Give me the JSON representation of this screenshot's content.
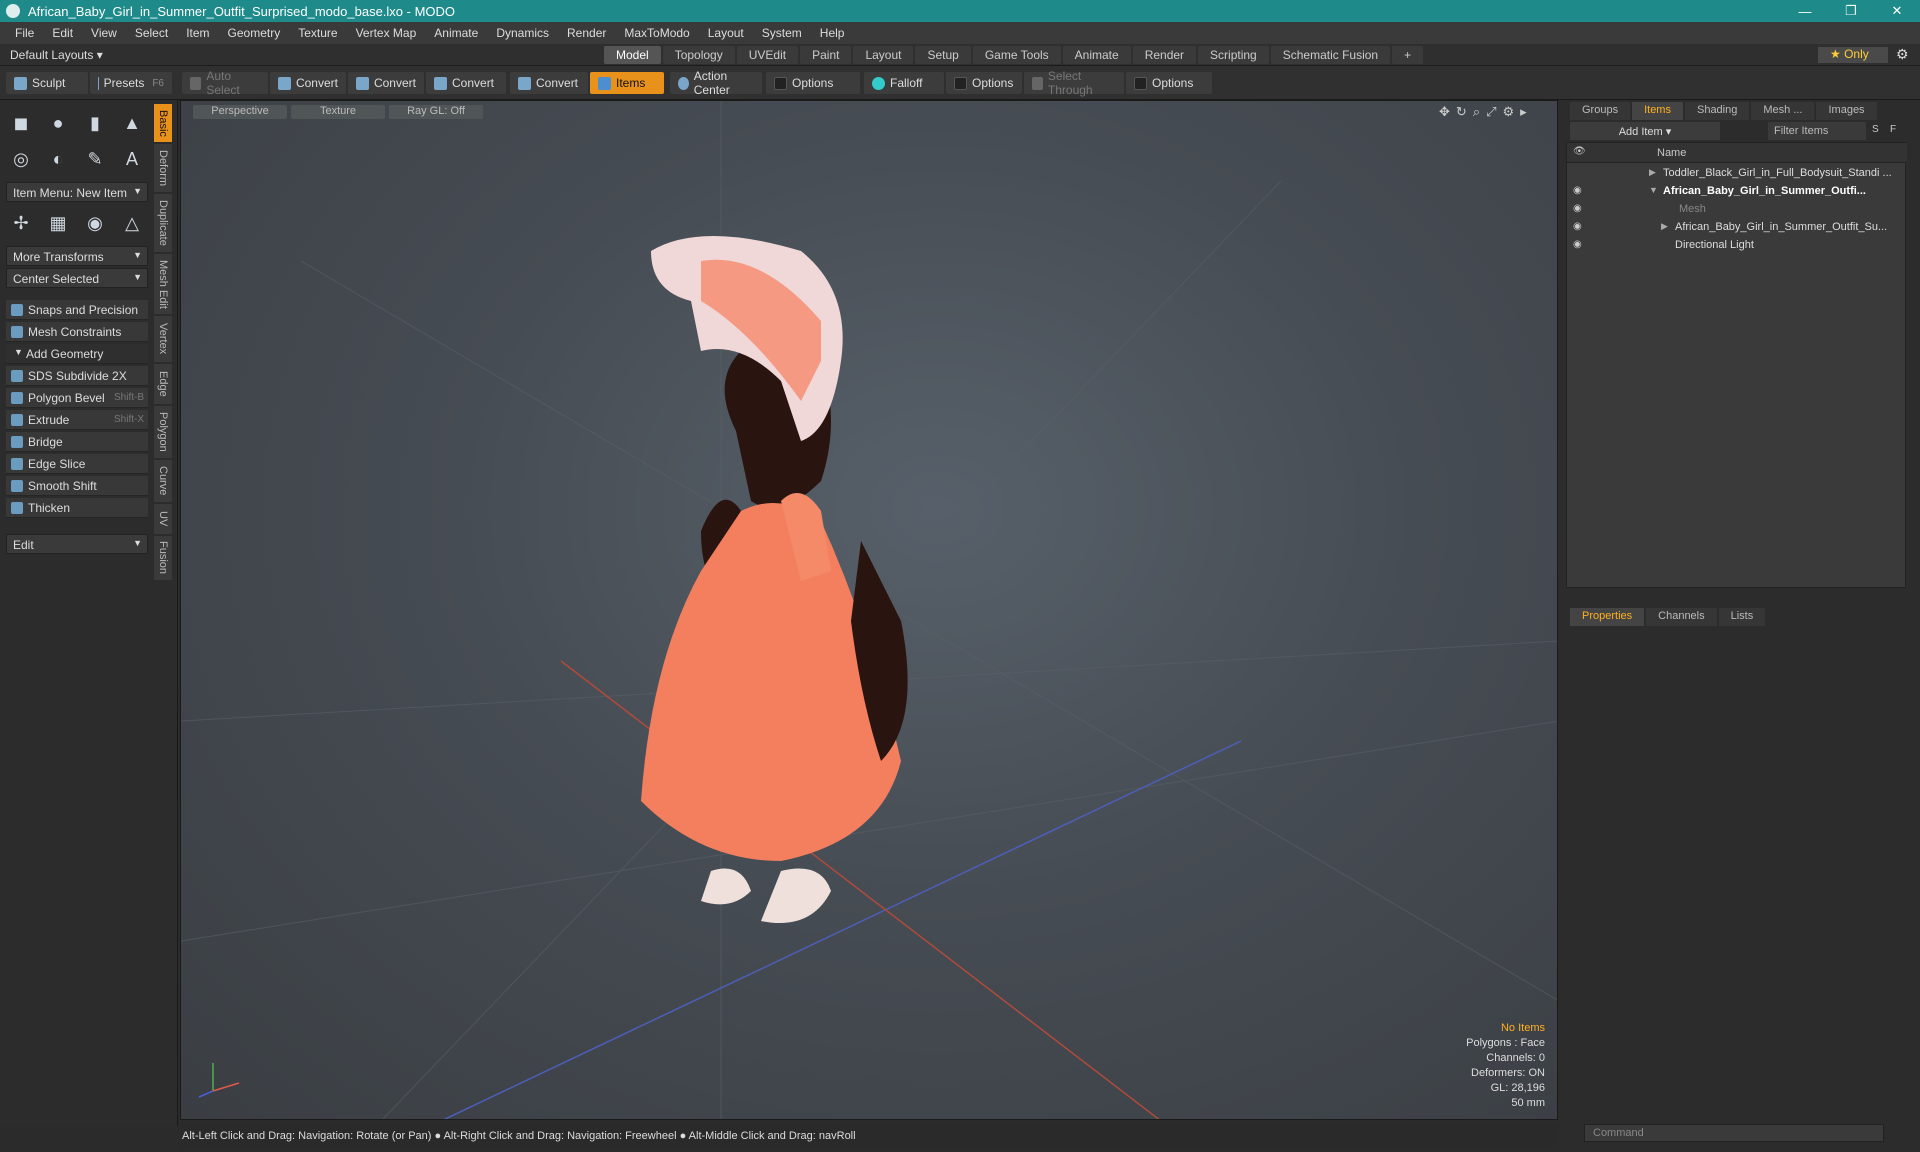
{
  "window": {
    "title": "African_Baby_Girl_in_Summer_Outfit_Surprised_modo_base.lxo - MODO",
    "minimize": "—",
    "restore": "❐",
    "close": "✕"
  },
  "menu": [
    "File",
    "Edit",
    "View",
    "Select",
    "Item",
    "Geometry",
    "Texture",
    "Vertex Map",
    "Animate",
    "Dynamics",
    "Render",
    "MaxToModo",
    "Layout",
    "System",
    "Help"
  ],
  "layoutbar": {
    "default_layouts": "Default Layouts ▾",
    "tabs": [
      "Model",
      "Topology",
      "UVEdit",
      "Paint",
      "Layout",
      "Setup",
      "Game Tools",
      "Animate",
      "Render",
      "Scripting",
      "Schematic Fusion"
    ],
    "active_tab": "Model",
    "add": "+",
    "only": "★ Only"
  },
  "toolbar": {
    "sculpt": "Sculpt",
    "presets": "Presets",
    "presets_key": "F6",
    "auto_select": "Auto Select",
    "convert1": "Convert",
    "convert2": "Convert",
    "convert3": "Convert",
    "convert4": "Convert",
    "items": "Items",
    "action_center": "Action Center",
    "options1": "Options",
    "falloff": "Falloff",
    "options2": "Options",
    "select_through": "Select Through",
    "options3": "Options"
  },
  "left": {
    "item_menu": "Item Menu: New Item",
    "more_transforms": "More Transforms",
    "center_selected": "Center Selected",
    "snaps": "Snaps and Precision",
    "mesh_constraints": "Mesh Constraints",
    "add_geometry": "Add Geometry",
    "tools": [
      {
        "label": "SDS Subdivide 2X",
        "key": ""
      },
      {
        "label": "Polygon Bevel",
        "key": "Shift-B"
      },
      {
        "label": "Extrude",
        "key": "Shift-X"
      },
      {
        "label": "Bridge",
        "key": ""
      },
      {
        "label": "Edge Slice",
        "key": ""
      },
      {
        "label": "Smooth Shift",
        "key": ""
      },
      {
        "label": "Thicken",
        "key": ""
      }
    ],
    "edit": "Edit"
  },
  "vtabs": [
    "Basic",
    "Deform",
    "Duplicate",
    "Mesh Edit",
    "Vertex",
    "Edge",
    "Polygon",
    "Curve",
    "UV",
    "Fusion"
  ],
  "viewport": {
    "perspective": "Perspective",
    "texture": "Texture",
    "raygl": "Ray GL: Off",
    "info": {
      "no_items": "No Items",
      "polygons": "Polygons : Face",
      "channels": "Channels: 0",
      "deformers": "Deformers: ON",
      "gl": "GL: 28,196",
      "mm": "50 mm"
    }
  },
  "status": "Alt-Left Click and Drag: Navigation: Rotate (or Pan) ● Alt-Right Click and Drag: Navigation: Freewheel ● Alt-Middle Click and Drag: navRoll",
  "right": {
    "tabs": [
      "Groups",
      "Items",
      "Shading",
      "Mesh ...",
      "Images"
    ],
    "active_tab": "Items",
    "add_item": "Add Item",
    "filter": "Filter Items",
    "s": "S",
    "f": "F",
    "name_col": "Name",
    "items": [
      {
        "label": "Toddler_Black_Girl_in_Full_Bodysuit_Standi ...",
        "indent": 0
      },
      {
        "label": "African_Baby_Girl_in_Summer_Outfi...",
        "indent": 0
      },
      {
        "label": "Mesh",
        "indent": 1
      },
      {
        "label": "African_Baby_Girl_in_Summer_Outfit_Su...",
        "indent": 1
      },
      {
        "label": "Directional Light",
        "indent": 1
      }
    ],
    "prop_tabs": [
      "Properties",
      "Channels",
      "Lists"
    ],
    "command": "Command"
  }
}
